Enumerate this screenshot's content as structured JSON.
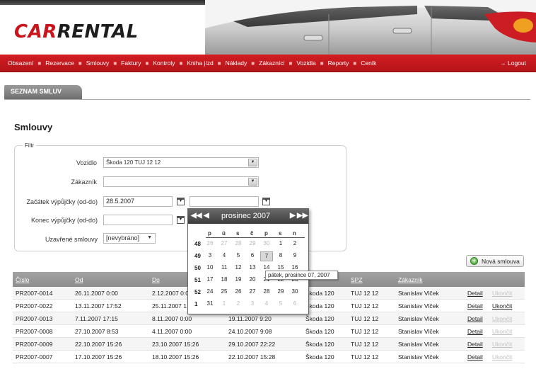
{
  "brand": {
    "car": "CAR",
    "rental": "RENTAL"
  },
  "nav": {
    "items": [
      "Obsazení",
      "Rezervace",
      "Smlouvy",
      "Faktury",
      "Kontroly",
      "Kniha jízd",
      "Náklady",
      "Zákazníci",
      "Vozidla",
      "Reporty",
      "Ceník"
    ],
    "logout": "→ Logout"
  },
  "section_tab": "SEZNAM SMLUV",
  "page_title": "Smlouvy",
  "filter": {
    "legend": "Filtr",
    "vozidlo_label": "Vozidlo",
    "vozidlo_value": "Škoda 120 TUJ 12 12",
    "zakaznik_label": "Zákazník",
    "zakaznik_value": "",
    "zacatek_label": "Začátek výpůjčky (od-do)",
    "zacatek_od": "28.5.2007",
    "zacatek_do": "",
    "konec_label": "Konec výpůjčky (od-do)",
    "konec_od": "",
    "uzavrene_label": "Uzavřené smlouvy",
    "uzavrene_value": "[nevybráno]"
  },
  "new_button": "Nová smlouva",
  "table": {
    "headers": [
      "Číslo",
      "Od",
      "Do",
      "",
      "",
      "SPZ",
      "Zákazník"
    ],
    "rows": [
      {
        "cislo": "PR2007-0014",
        "od": "26.11.2007 0:00",
        "do": "2.12.2007 0:0",
        "realny": "",
        "vuz": "Škoda 120",
        "spz": "TUJ 12 12",
        "zakaznik": "Stanislav Vlček",
        "detail": "Detail",
        "ukoncit": "Ukončit"
      },
      {
        "cislo": "PR2007-0022",
        "od": "13.11.2007 17:52",
        "do": "25.11.2007 1",
        "realny": "",
        "vuz": "Škoda 120",
        "spz": "TUJ 12 12",
        "zakaznik": "Stanislav Vlček",
        "detail": "Detail",
        "ukoncit": "Ukončit"
      },
      {
        "cislo": "PR2007-0013",
        "od": "7.11.2007 17:15",
        "do": "8.11.2007 0:00",
        "realny": "19.11.2007 9:20",
        "vuz": "Škoda 120",
        "spz": "TUJ 12 12",
        "zakaznik": "Stanislav Vlček",
        "detail": "Detail",
        "ukoncit": "Ukončit"
      },
      {
        "cislo": "PR2007-0008",
        "od": "27.10.2007 8:53",
        "do": "4.11.2007 0:00",
        "realny": "24.10.2007 9:08",
        "vuz": "Škoda 120",
        "spz": "TUJ 12 12",
        "zakaznik": "Stanislav Vlček",
        "detail": "Detail",
        "ukoncit": "Ukončit"
      },
      {
        "cislo": "PR2007-0009",
        "od": "22.10.2007 15:26",
        "do": "23.10.2007 15:26",
        "realny": "29.10.2007 22:22",
        "vuz": "Škoda 120",
        "spz": "TUJ 12 12",
        "zakaznik": "Stanislav Vlček",
        "detail": "Detail",
        "ukoncit": "Ukončit"
      },
      {
        "cislo": "PR2007-0007",
        "od": "17.10.2007 15:26",
        "do": "18.10.2007 15:26",
        "realny": "22.10.2007 15:28",
        "vuz": "Škoda 120",
        "spz": "TUJ 12 12",
        "zakaznik": "Stanislav Vlček",
        "detail": "Detail",
        "ukoncit": "Ukončit"
      }
    ]
  },
  "calendar": {
    "month": "prosinec 2007",
    "dow": [
      "p",
      "ú",
      "s",
      "č",
      "p",
      "s",
      "n"
    ],
    "weeks": [
      {
        "wk": "48",
        "days": [
          "26",
          "27",
          "28",
          "29",
          "30",
          "1",
          "2"
        ]
      },
      {
        "wk": "49",
        "days": [
          "3",
          "4",
          "5",
          "6",
          "7",
          "8",
          "9"
        ]
      },
      {
        "wk": "50",
        "days": [
          "10",
          "11",
          "12",
          "13",
          "14",
          "15",
          "16"
        ]
      },
      {
        "wk": "51",
        "days": [
          "17",
          "18",
          "19",
          "20",
          "21",
          "22",
          "23"
        ]
      },
      {
        "wk": "52",
        "days": [
          "24",
          "25",
          "26",
          "27",
          "28",
          "29",
          "30"
        ]
      },
      {
        "wk": "1",
        "days": [
          "31",
          "1",
          "2",
          "3",
          "4",
          "5",
          "6"
        ]
      }
    ],
    "tooltip": "pátek, prosince 07, 2007"
  }
}
